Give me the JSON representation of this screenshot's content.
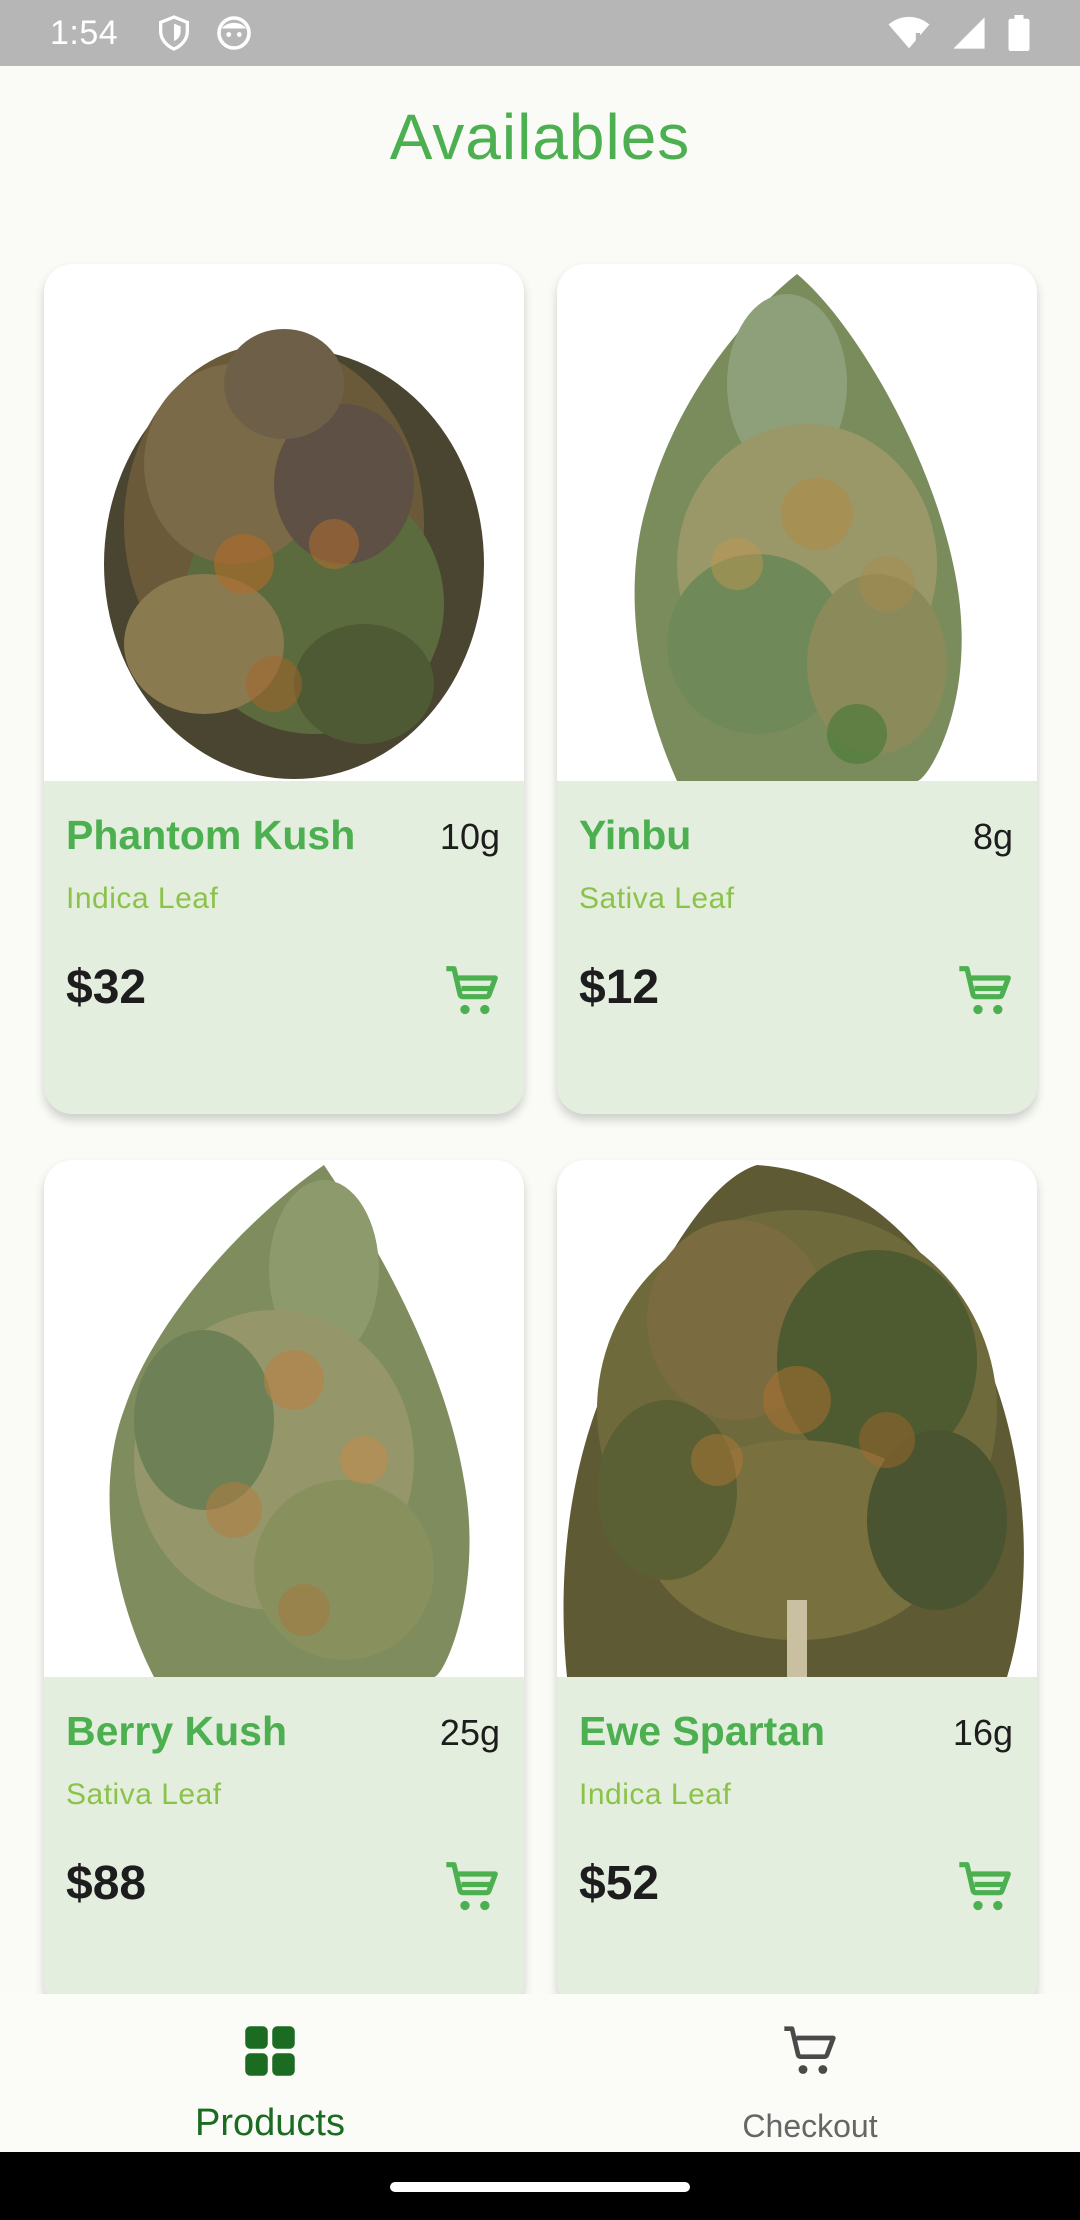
{
  "status_bar": {
    "time": "1:54",
    "icons": [
      "shield-icon",
      "face-icon",
      "wifi-icon",
      "signal-icon",
      "battery-icon"
    ]
  },
  "page": {
    "title": "Availables"
  },
  "products": [
    {
      "name": "Phantom Kush",
      "weight": "10g",
      "type": "Indica Leaf",
      "price": "$32"
    },
    {
      "name": "Yinbu",
      "weight": "8g",
      "type": "Sativa Leaf",
      "price": "$12"
    },
    {
      "name": "Berry Kush",
      "weight": "25g",
      "type": "Sativa Leaf",
      "price": "$88"
    },
    {
      "name": "Ewe Spartan",
      "weight": "16g",
      "type": "Indica Leaf",
      "price": "$52"
    }
  ],
  "bottom_nav": {
    "products_label": "Products",
    "checkout_label": "Checkout",
    "active": "Products"
  },
  "colors": {
    "accent_green": "#4caf50",
    "type_green": "#8bc34a",
    "card_bg": "#e4eedf",
    "nav_active": "#1b6b23"
  }
}
